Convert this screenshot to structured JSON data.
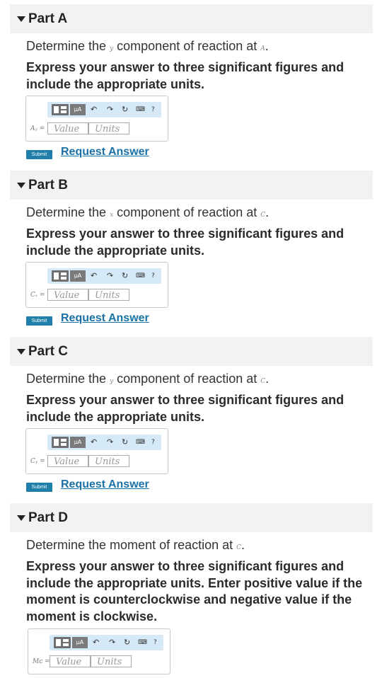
{
  "instruction_sig": "Express your answer to three significant figures and include the appropriate units.",
  "toolbar": {
    "mu_label": "μA",
    "undo_icon": "undo-icon",
    "redo_icon": "redo-icon",
    "reset_icon": "reset-icon",
    "keyboard_icon": "keyboard-icon",
    "help_label": "?"
  },
  "fields": {
    "value_placeholder": "Value",
    "units_placeholder": "Units"
  },
  "submit_label": "Submit",
  "request_label": "Request Answer",
  "parts": [
    {
      "title": "Part A",
      "question_pre": "Determine the ",
      "question_var": "y",
      "question_mid": " component of reaction at ",
      "question_point": "A",
      "question_end": ".",
      "answer_label": "Aᵧ ="
    },
    {
      "title": "Part B",
      "question_pre": "Determine the ",
      "question_var": "x",
      "question_mid": " component of reaction at ",
      "question_point": "C",
      "question_end": ".",
      "answer_label": "Cₓ ="
    },
    {
      "title": "Part C",
      "question_pre": "Determine the ",
      "question_var": "y",
      "question_mid": " component of reaction at ",
      "question_point": "C",
      "question_end": ".",
      "answer_label": "Cᵧ ="
    },
    {
      "title": "Part D",
      "question_pre": "Determine the moment of reaction at ",
      "question_point": "C",
      "question_end": ".",
      "instruction": "Express your answer to three significant figures and include the appropriate units. Enter positive value if the moment is counterclockwise and negative value if the moment is clockwise.",
      "answer_label": "Mᴄ ="
    }
  ]
}
